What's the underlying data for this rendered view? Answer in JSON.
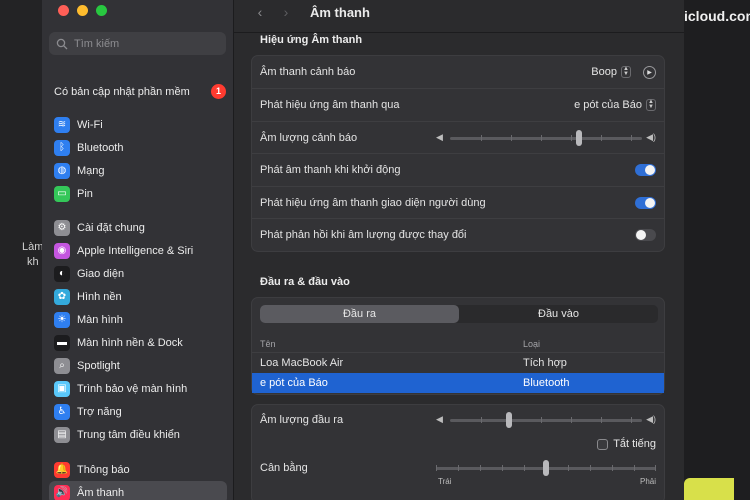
{
  "background": {
    "left_text": "Làm\nkh",
    "right_text": "icloud.com"
  },
  "sidebar": {
    "search_placeholder": "Tìm kiếm",
    "update": {
      "label": "Có bản cập nhật phần mềm",
      "badge": "1"
    },
    "group1": [
      {
        "label": "Wi‑Fi",
        "icon": "wifi-icon",
        "color": "#2f7ff0",
        "glyph": "≋"
      },
      {
        "label": "Bluetooth",
        "icon": "bluetooth-icon",
        "color": "#2f7ff0",
        "glyph": "ᛒ"
      },
      {
        "label": "Mạng",
        "icon": "globe-icon",
        "color": "#2f7ff0",
        "glyph": "◍"
      },
      {
        "label": "Pin",
        "icon": "battery-icon",
        "color": "#34c759",
        "glyph": "▭"
      }
    ],
    "group2": [
      {
        "label": "Cài đặt chung",
        "icon": "gear-icon",
        "color": "#8e8e93",
        "glyph": "⚙"
      },
      {
        "label": "Apple Intelligence & Siri",
        "icon": "siri-icon",
        "color": "#c456e0",
        "glyph": "◉"
      },
      {
        "label": "Giao diện",
        "icon": "appearance-icon",
        "color": "#1c1c1e",
        "glyph": "◐"
      },
      {
        "label": "Hình nền",
        "icon": "wallpaper-icon",
        "color": "#34aadc",
        "glyph": "✿"
      },
      {
        "label": "Màn hình",
        "icon": "display-icon",
        "color": "#2f7ff0",
        "glyph": "☀"
      },
      {
        "label": "Màn hình nền & Dock",
        "icon": "dock-icon",
        "color": "#1c1c1e",
        "glyph": "▬"
      },
      {
        "label": "Spotlight",
        "icon": "spotlight-icon",
        "color": "#8e8e93",
        "glyph": "⌕"
      },
      {
        "label": "Trình bảo vệ màn hình",
        "icon": "screensaver-icon",
        "color": "#5ac8fa",
        "glyph": "▣"
      },
      {
        "label": "Trợ năng",
        "icon": "accessibility-icon",
        "color": "#2f7ff0",
        "glyph": "♿"
      },
      {
        "label": "Trung tâm điều khiển",
        "icon": "control-center-icon",
        "color": "#8e8e93",
        "glyph": "▤"
      }
    ],
    "group3": [
      {
        "label": "Thông báo",
        "icon": "notifications-icon",
        "color": "#ff3b30",
        "glyph": "🔔"
      },
      {
        "label": "Âm thanh",
        "icon": "sound-icon",
        "color": "#ff2d55",
        "glyph": "🔊"
      }
    ]
  },
  "main": {
    "title": "Âm thanh",
    "effects": {
      "section_title": "Hiệu ứng Âm thanh",
      "alert_sound_label": "Âm thanh cảnh báo",
      "alert_sound_value": "Boop",
      "play_through_label": "Phát hiệu ứng âm thanh qua",
      "play_through_value": "e pót của Báo",
      "alert_volume_label": "Âm lượng cảnh báo",
      "alert_volume_level": 0.68,
      "startup_label": "Phát âm thanh khi khởi động",
      "startup_on": true,
      "ui_effects_label": "Phát hiệu ứng âm thanh giao diện người dùng",
      "ui_effects_on": true,
      "volume_feedback_label": "Phát phản hồi khi âm lượng được thay đổi",
      "volume_feedback_on": false
    },
    "io": {
      "section_title": "Đầu ra & đầu vào",
      "tab_output": "Đầu ra",
      "tab_input": "Đầu vào",
      "col_name": "Tên",
      "col_type": "Loại",
      "devices": [
        {
          "name": "Loa MacBook Air",
          "type": "Tích hợp",
          "selected": false
        },
        {
          "name": "e pót của Báo",
          "type": "Bluetooth",
          "selected": true
        }
      ]
    },
    "output": {
      "volume_label": "Âm lượng đầu ra",
      "volume_level": 0.3,
      "mute_label": "Tắt tiếng",
      "balance_label": "Cân bằng",
      "balance_level": 0.5,
      "balance_left": "Trái",
      "balance_right": "Phải"
    }
  }
}
